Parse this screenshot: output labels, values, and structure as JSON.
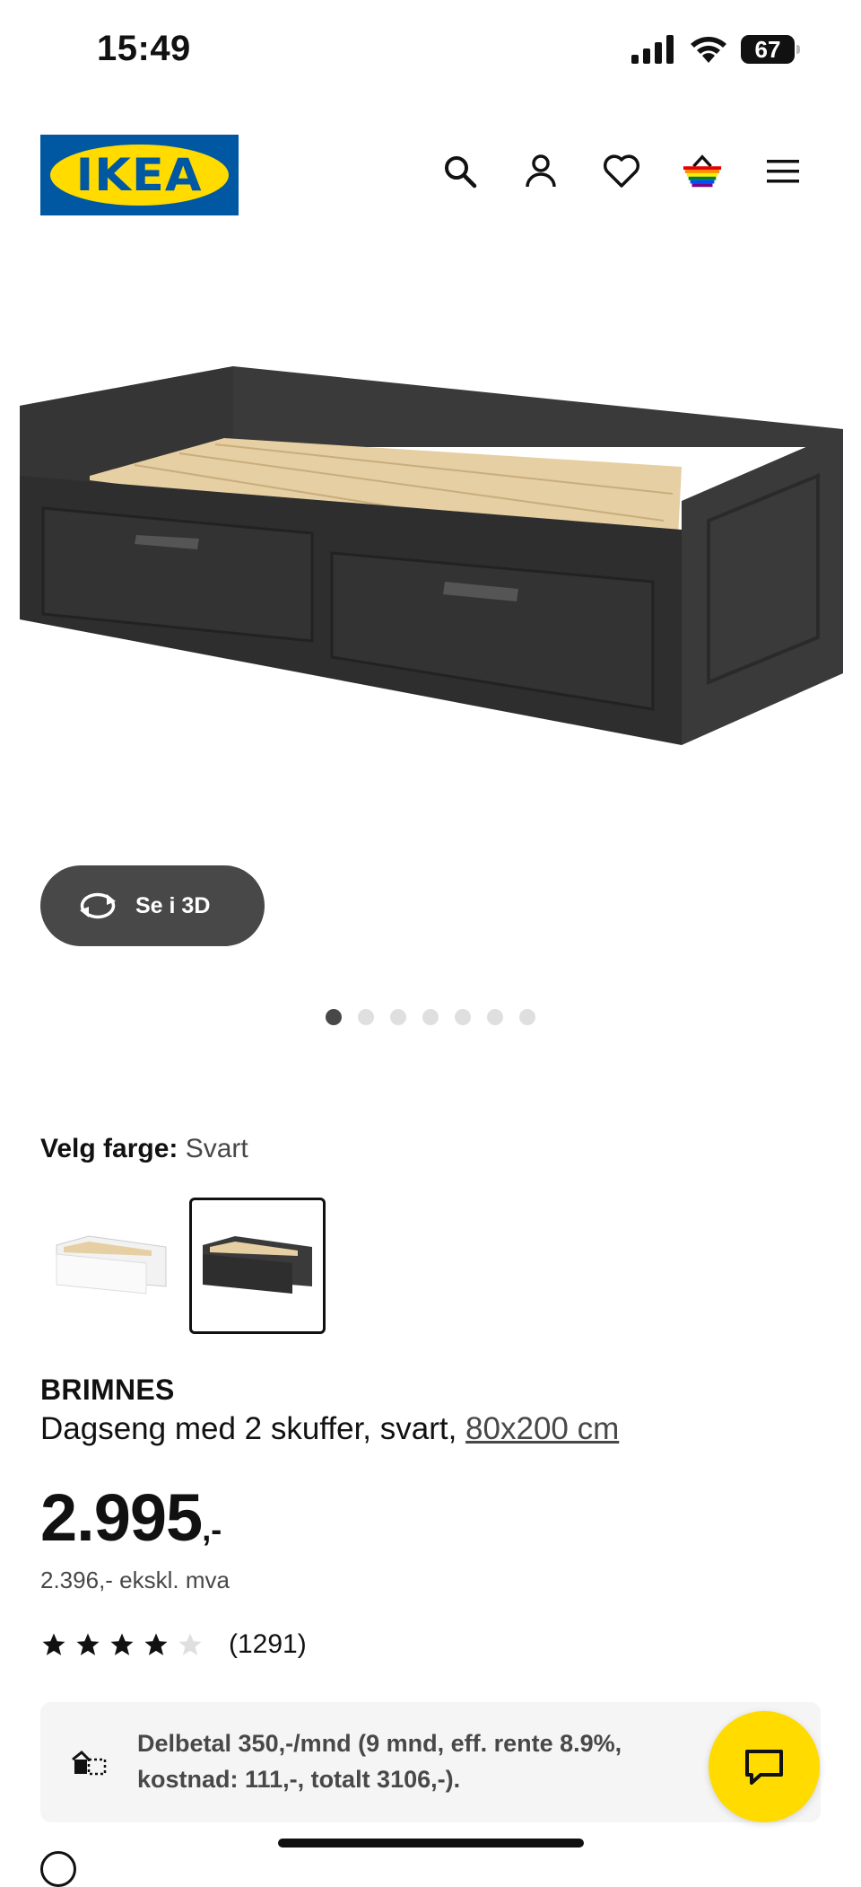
{
  "status_bar": {
    "time": "15:49",
    "battery": "67"
  },
  "header": {
    "logo_text": "IKEA",
    "icons": [
      "search-icon",
      "user-icon",
      "heart-icon",
      "basket-icon",
      "menu-icon"
    ]
  },
  "gallery": {
    "view_3d_label": "Se i 3D",
    "dot_count": 7,
    "active_dot": 1
  },
  "color_selector": {
    "label": "Velg farge:",
    "value": "Svart",
    "options": [
      "Hvit",
      "Svart"
    ],
    "selected": "Svart"
  },
  "product": {
    "name": "BRIMNES",
    "description": "Dagseng med 2 skuffer, svart, ",
    "size_link": "80x200 cm",
    "price_main": "2.995",
    "price_suffix": ",-",
    "price_ex_vat": "2.396,- ekskl. mva",
    "rating_stars": 4,
    "rating_max": 5,
    "rating_count": "(1291)"
  },
  "finance": {
    "text": "Delbetal 350,-/mnd (9 mnd, eff. rente 8.9%, kostnad: 111,-, totalt 3106,-)."
  },
  "colors": {
    "ikea_blue": "#0058a3",
    "ikea_yellow": "#ffdb00",
    "dark_grey": "#484848"
  }
}
